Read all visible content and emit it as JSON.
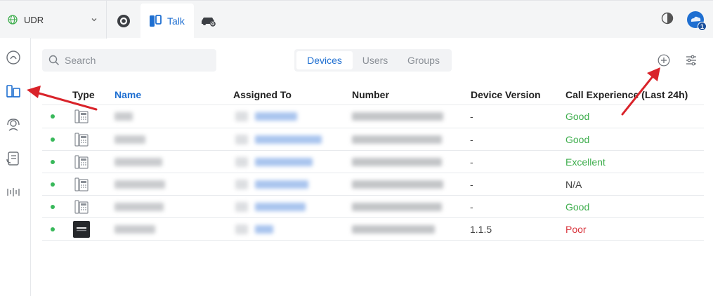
{
  "site": {
    "name": "UDR"
  },
  "apps": {
    "talk_label": "Talk"
  },
  "header": {
    "notification_count": "1"
  },
  "search": {
    "placeholder": "Search"
  },
  "tabs": [
    {
      "label": "Devices",
      "active": true
    },
    {
      "label": "Users",
      "active": false
    },
    {
      "label": "Groups",
      "active": false
    }
  ],
  "table": {
    "columns": [
      "Type",
      "Name",
      "Assigned To",
      "Number",
      "Device Version",
      "Call Experience (Last 24h)"
    ],
    "rows": [
      {
        "device_version": "-",
        "call_experience": "Good",
        "quality": "good",
        "device_type": "desk-phone"
      },
      {
        "device_version": "-",
        "call_experience": "Good",
        "quality": "good",
        "device_type": "desk-phone"
      },
      {
        "device_version": "-",
        "call_experience": "Excellent",
        "quality": "excellent",
        "device_type": "desk-phone"
      },
      {
        "device_version": "-",
        "call_experience": "N/A",
        "quality": "na",
        "device_type": "desk-phone"
      },
      {
        "device_version": "-",
        "call_experience": "Good",
        "quality": "good",
        "device_type": "desk-phone"
      },
      {
        "device_version": "1.1.5",
        "call_experience": "Poor",
        "quality": "poor",
        "device_type": "hardware-device"
      }
    ]
  },
  "colors": {
    "accent": "#1f6fd1",
    "status_online": "#38b85a",
    "good": "#3fae4e",
    "poor": "#d9363e",
    "annotation_arrow": "#d9232a"
  },
  "icons": {
    "site": "globe-icon",
    "network_app": "network-app-icon",
    "talk_app": "talk-app-icon",
    "access_app": "access-app-icon",
    "theme": "theme-toggle-icon",
    "account": "cloud-account-icon",
    "sidebar": [
      "dashboard-icon",
      "devices-icon",
      "users-icon",
      "contacts-icon",
      "voicemail-icon"
    ],
    "add": "add-icon",
    "filter": "filter-settings-icon"
  }
}
